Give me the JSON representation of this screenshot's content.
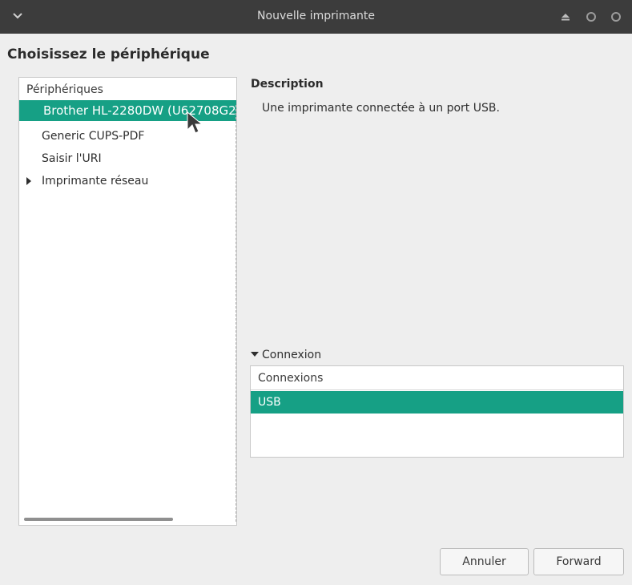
{
  "window": {
    "title": "Nouvelle imprimante",
    "icons": [
      "chevron-down-icon",
      "eject-icon",
      "circle-minimize-icon",
      "circle-maximize-icon"
    ]
  },
  "page": {
    "heading": "Choisissez le périphérique"
  },
  "devices": {
    "header": "Périphériques",
    "items": [
      {
        "label": "Brother HL-2280DW (U62708G2",
        "selected": true
      },
      {
        "label": "Generic CUPS-PDF",
        "selected": false
      },
      {
        "label": "Saisir l'URI",
        "selected": false
      },
      {
        "label": "Imprimante réseau",
        "selected": false,
        "expandable": true
      }
    ]
  },
  "description": {
    "title": "Description",
    "text": "Une imprimante connectée à un port USB."
  },
  "connection": {
    "toggle_label": "Connexion",
    "column_header": "Connexions",
    "rows": [
      "USB"
    ]
  },
  "buttons": {
    "cancel": "Annuler",
    "forward": "Forward"
  },
  "colors": {
    "accent": "#16a085",
    "titlebar": "#3c3c3c",
    "background": "#eeeeee"
  }
}
